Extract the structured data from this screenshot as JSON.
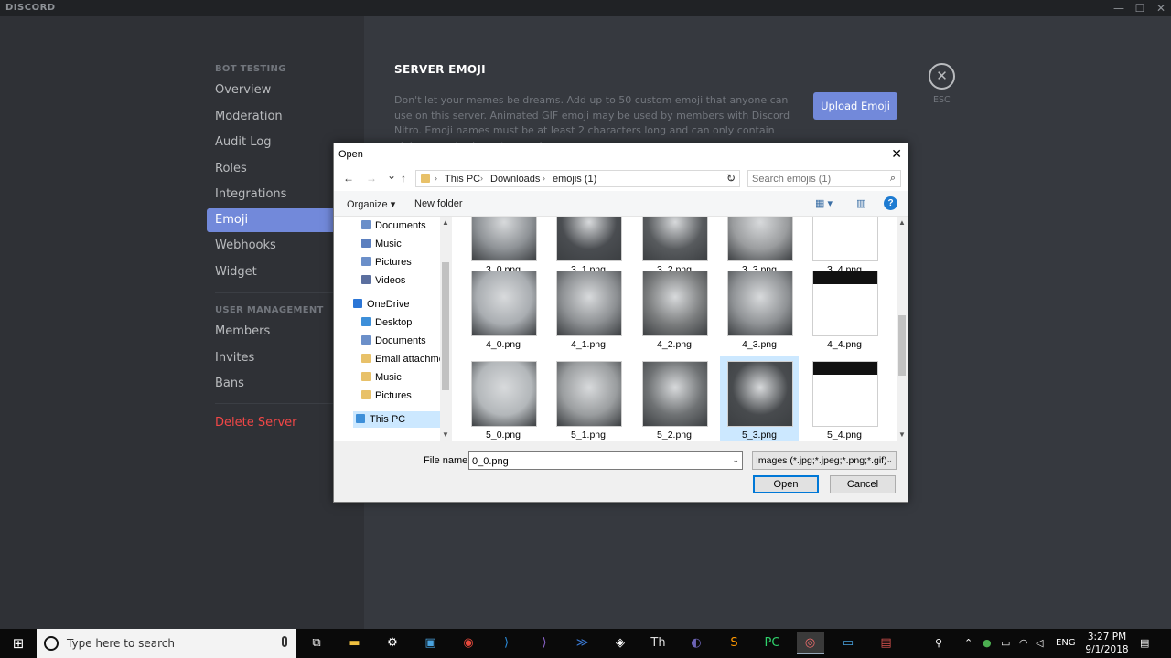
{
  "window": {
    "app_title": "DISCORD",
    "minimize": "—",
    "maximize": "☐",
    "close": "✕"
  },
  "sidebar": {
    "section1_header": "BOT TESTING",
    "section1_items": [
      {
        "label": "Overview"
      },
      {
        "label": "Moderation"
      },
      {
        "label": "Audit Log"
      },
      {
        "label": "Roles"
      },
      {
        "label": "Integrations"
      },
      {
        "label": "Emoji"
      },
      {
        "label": "Webhooks"
      },
      {
        "label": "Widget"
      }
    ],
    "active_item": "Emoji",
    "section2_header": "USER MANAGEMENT",
    "section2_items": [
      {
        "label": "Members"
      },
      {
        "label": "Invites"
      },
      {
        "label": "Bans"
      }
    ],
    "danger_item": "Delete Server"
  },
  "main": {
    "title": "SERVER EMOJI",
    "description": "Don't let your memes be dreams. Add up to 50 custom emoji that anyone can use on this server. Animated GIF emoji may be used by members with Discord Nitro. Emoji names must be at least 2 characters long and can only contain alphanumeric characters and",
    "upload_button": "Upload Emoji",
    "close_symbol": "✕",
    "esc_label": "ESC"
  },
  "dialog": {
    "title": "Open",
    "close_symbol": "✕",
    "nav": {
      "back": "←",
      "forward": "→",
      "recent": "⌄",
      "up": "↑",
      "refresh": "↻"
    },
    "breadcrumb": [
      "This PC",
      "Downloads",
      "emojis (1)"
    ],
    "breadcrumb_sep": "›",
    "search_placeholder": "Search emojis (1)",
    "search_icon": "⌕",
    "toolbar": {
      "organize": "Organize ▾",
      "new_folder": "New folder",
      "view_icon": "▦ ▾",
      "pane_icon": "▥",
      "help": "?"
    },
    "tree": [
      {
        "label": "Documents",
        "pinned": true,
        "color": "#6b8fc9"
      },
      {
        "label": "Music",
        "pinned": true,
        "color": "#5b7fbf"
      },
      {
        "label": "Pictures",
        "pinned": true,
        "color": "#6b8fc9"
      },
      {
        "label": "Videos",
        "pinned": true,
        "color": "#5b6f9f"
      },
      {
        "label": "OneDrive",
        "pinned": false,
        "color": "#2b76d6"
      },
      {
        "label": "Desktop",
        "pinned": false,
        "color": "#3d8fd9"
      },
      {
        "label": "Documents",
        "pinned": false,
        "color": "#6b8fc9"
      },
      {
        "label": "Email attachments",
        "pinned": false,
        "color": "#e8c169"
      },
      {
        "label": "Music",
        "pinned": false,
        "color": "#e8c169"
      },
      {
        "label": "Pictures",
        "pinned": false,
        "color": "#e8c169"
      },
      {
        "label": "This PC",
        "pinned": false,
        "color": "#3d8fd9"
      }
    ],
    "pin_symbol": "📌",
    "scroll_up": "▲",
    "scroll_down": "▼",
    "files": [
      {
        "name": "3_0.png",
        "tone": "#8e9296"
      },
      {
        "name": "3_1.png",
        "tone": "#4a4d51"
      },
      {
        "name": "3_2.png",
        "tone": "#585b5e"
      },
      {
        "name": "3_3.png",
        "tone": "#9a9c9e"
      },
      {
        "name": "3_4.png",
        "tone": "blank"
      },
      {
        "name": "4_0.png",
        "tone": "#a9adb1"
      },
      {
        "name": "4_1.png",
        "tone": "#8d9093"
      },
      {
        "name": "4_2.png",
        "tone": "#7b7d7e"
      },
      {
        "name": "4_3.png",
        "tone": "#8f9295"
      },
      {
        "name": "4_4.png",
        "tone": "topdark"
      },
      {
        "name": "5_0.png",
        "tone": "#b3b7ba"
      },
      {
        "name": "5_1.png",
        "tone": "#9a9d9f"
      },
      {
        "name": "5_2.png",
        "tone": "#6f7274"
      },
      {
        "name": "5_3.png",
        "tone": "#484b4e"
      },
      {
        "name": "5_4.png",
        "tone": "topdark"
      }
    ],
    "selected_file": "5_3.png",
    "file_name_label": "File name:",
    "file_name_value": "0_0.png",
    "filter": "Images (*.jpg;*.jpeg;*.png;*.gif)",
    "open_button": "Open",
    "cancel_button": "Cancel",
    "dropdown_symbol": "⌄"
  },
  "taskbar": {
    "start_symbol": "⊞",
    "search_placeholder": "Type here to search",
    "apps": [
      {
        "name": "task-view",
        "glyph": "⧉",
        "color": "#ffffff"
      },
      {
        "name": "file-explorer",
        "glyph": "▬",
        "color": "#f0c040"
      },
      {
        "name": "settings",
        "glyph": "⚙",
        "color": "#ffffff"
      },
      {
        "name": "store",
        "glyph": "▣",
        "color": "#4aa3df"
      },
      {
        "name": "chrome",
        "glyph": "◉",
        "color": "#e7493c"
      },
      {
        "name": "vscode",
        "glyph": "⟩",
        "color": "#2b8fe0"
      },
      {
        "name": "visual-studio",
        "glyph": "⟩",
        "color": "#8a62c8"
      },
      {
        "name": "powershell",
        "glyph": "≫",
        "color": "#3b7bd6"
      },
      {
        "name": "unity",
        "glyph": "◈",
        "color": "#ffffff"
      },
      {
        "name": "typora",
        "glyph": "Th",
        "color": "#dddddd"
      },
      {
        "name": "eclipse",
        "glyph": "◐",
        "color": "#6c63b5"
      },
      {
        "name": "sublime",
        "glyph": "S",
        "color": "#ff9800"
      },
      {
        "name": "pycharm",
        "glyph": "PC",
        "color": "#2fd26b"
      },
      {
        "name": "discord",
        "glyph": "◎",
        "color": "#f26d6d"
      },
      {
        "name": "window-app",
        "glyph": "▭",
        "color": "#4aa3df"
      },
      {
        "name": "flag-app",
        "glyph": "▤",
        "color": "#d9534f"
      }
    ],
    "active_app": "discord",
    "tray": {
      "people": "⚲",
      "chevron": "⌃",
      "lang": "ENG",
      "notifications": "▤"
    },
    "time": "3:27 PM",
    "date": "9/1/2018"
  }
}
